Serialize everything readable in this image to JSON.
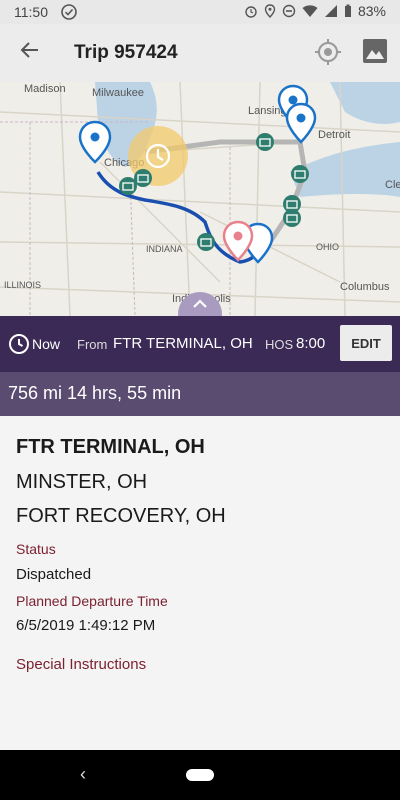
{
  "status_bar": {
    "time": "11:50",
    "battery": "83%"
  },
  "app_bar": {
    "title": "Trip 957424"
  },
  "map": {
    "labels": [
      "Madison",
      "Milwaukee",
      "Lansing",
      "Detroit",
      "Chicago",
      "INDIANA",
      "OHIO",
      "ILLINOIS",
      "Indianapolis",
      "Columbus",
      "Cle"
    ]
  },
  "info_bar": {
    "now": "Now",
    "from_label": "From",
    "from_value": "FTR TERMINAL, OH",
    "hos_label": "HOS",
    "hos_value": "8:00",
    "edit": "EDIT"
  },
  "summary": "756 mi 14 hrs, 55 min",
  "details": {
    "name": "FTR TERMINAL, OH",
    "line1": "MINSTER, OH",
    "line2": "FORT RECOVERY, OH",
    "status_label": "Status",
    "status_value": "Dispatched",
    "departure_label": "Planned Departure Time",
    "departure_value": "6/5/2019 1:49:12 PM",
    "instructions_label": "Special Instructions"
  },
  "colors": {
    "header": "#3a2a55",
    "summary": "#5a4b70",
    "label": "#7a1f2e",
    "route": "#1a4fb0"
  },
  "icons": [
    "check-circle-icon",
    "alarm-icon",
    "location-icon",
    "dnd-icon",
    "wifi-icon",
    "signal-icon",
    "battery-icon",
    "back-arrow-icon",
    "locate-icon",
    "image-icon",
    "clock-icon",
    "expand-icon",
    "map-pin-icon",
    "scale-icon"
  ]
}
